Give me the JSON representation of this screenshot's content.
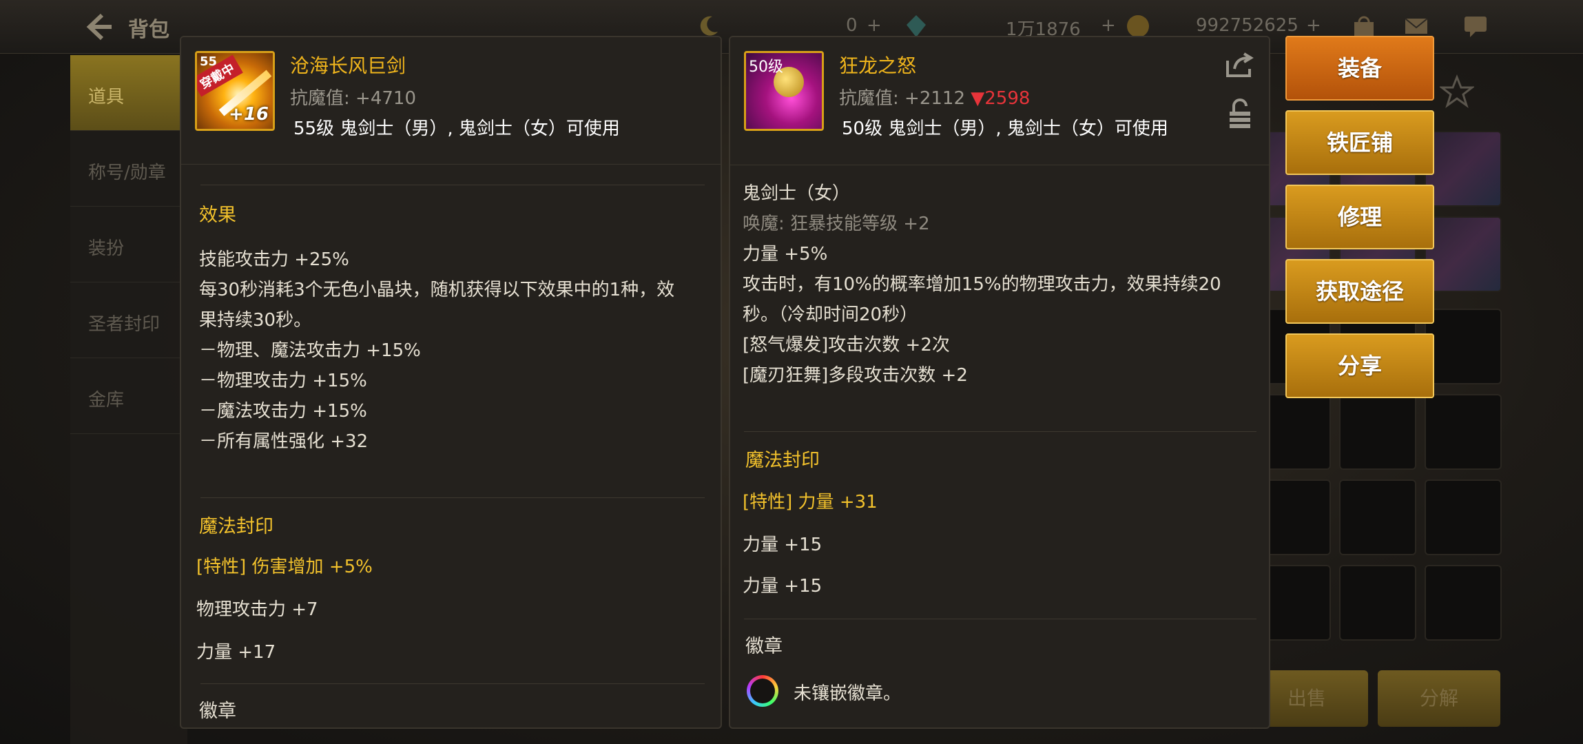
{
  "background": {
    "title": "背包",
    "currencies": [
      "0",
      "1万1876",
      "992752625"
    ],
    "nav_items": [
      "道具",
      "称号/勋章",
      "装扮",
      "圣者封印",
      "金库"
    ],
    "bottom_buttons": [
      "出售",
      "分解"
    ]
  },
  "left_item": {
    "name": "沧海长风巨剑",
    "icon_tag": "穿戴中",
    "icon_level_tag": "55",
    "icon_plus": "+16",
    "resist_label": "抗魔值: ",
    "resist_value": "+4710",
    "usable": "55级 鬼剑士（男）, 鬼剑士（女）可使用",
    "effect_title": "效果",
    "effect_lines": [
      "技能攻击力 +25%",
      "每30秒消耗3个无色小晶块，随机获得以下效果中的1种，效",
      "果持续30秒。",
      "－物理、魔法攻击力 +15%",
      "－物理攻击力 +15%",
      "－魔法攻击力 +15%",
      "－所有属性强化 +32"
    ],
    "seal_title": "魔法封印",
    "seal_lines": [
      "[特性] 伤害增加 +5%",
      "物理攻击力 +7",
      "力量 +17"
    ],
    "emblem_title": "徽章"
  },
  "right_item": {
    "name": "狂龙之怒",
    "icon_level": "50级",
    "resist_label": "抗魔值: ",
    "resist_value": "+2112",
    "resist_diff": "▼2598",
    "usable": "50级 鬼剑士（男）, 鬼剑士（女）可使用",
    "effect_lines": [
      "鬼剑士（女）",
      "唤魔: 狂暴技能等级 +2",
      "力量 +5%",
      "攻击时，有10%的概率增加15%的物理攻击力，效果持续20",
      "秒。（冷却时间20秒）",
      "[怒气爆发]攻击次数 +2次",
      "[魔刃狂舞]多段攻击次数 +2"
    ],
    "seal_title": "魔法封印",
    "seal_lines": [
      "[特性] 力量 +31",
      "力量 +15",
      "力量 +15"
    ],
    "emblem_title": "徽章",
    "emblem_text": "未镶嵌徽章。"
  },
  "actions": {
    "equip": "装备",
    "blacksmith": "铁匠铺",
    "repair": "修理",
    "obtain": "获取途径",
    "share": "分享"
  },
  "colors": {
    "item_name": "#f0b51c",
    "section_title": "#f3c22c",
    "resist_down": "#e8343a",
    "button": "#d99b1f",
    "button_primary": "#e07a1a"
  }
}
